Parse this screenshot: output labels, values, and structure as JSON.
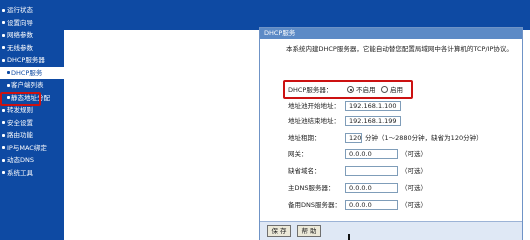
{
  "sidebar": {
    "items": [
      {
        "label": "运行状态",
        "sub": false
      },
      {
        "label": "设置向导",
        "sub": false
      },
      {
        "label": "网络参数",
        "sub": false
      },
      {
        "label": "无线参数",
        "sub": false
      },
      {
        "label": "DHCP服务器",
        "sub": false
      },
      {
        "label": "DHCP服务",
        "sub": true
      },
      {
        "label": "客户端列表",
        "sub": true
      },
      {
        "label": "静态地址分配",
        "sub": true
      },
      {
        "label": "转发规则",
        "sub": false
      },
      {
        "label": "安全设置",
        "sub": false
      },
      {
        "label": "路由功能",
        "sub": false
      },
      {
        "label": "IP与MAC绑定",
        "sub": false
      },
      {
        "label": "动态DNS",
        "sub": false
      },
      {
        "label": "系统工具",
        "sub": false
      }
    ],
    "active_index": 5
  },
  "dialog": {
    "title": "DHCP服务",
    "description": "本系统内建DHCP服务器，它能自动替您配置局域网中各计算机的TCP/IP协议。",
    "dhcp_label": "DHCP服务器：",
    "disable_label": "不启用",
    "enable_label": "启用",
    "dhcp_enabled": false,
    "start_label": "地址池开始地址：",
    "start_value": "192.168.1.100",
    "end_label": "地址池结束地址：",
    "end_value": "192.168.1.199",
    "lease_label": "地址租期：",
    "lease_value": "120",
    "lease_note": "分钟（1～2880分钟，缺省为120分钟）",
    "gateway_label": "网关：",
    "gateway_value": "0.0.0.0",
    "optional": "（可选）",
    "domain_label": "缺省域名：",
    "domain_value": "",
    "dns1_label": "主DNS服务器：",
    "dns1_value": "0.0.0.0",
    "dns2_label": "备用DNS服务器：",
    "dns2_value": "0.0.0.0",
    "save_label": "保 存",
    "help_label": "帮 助"
  },
  "colors": {
    "sidebar_bg": "#0e4aa3",
    "title_bar": "#5c8ac6",
    "annotation": "#cc1111"
  }
}
